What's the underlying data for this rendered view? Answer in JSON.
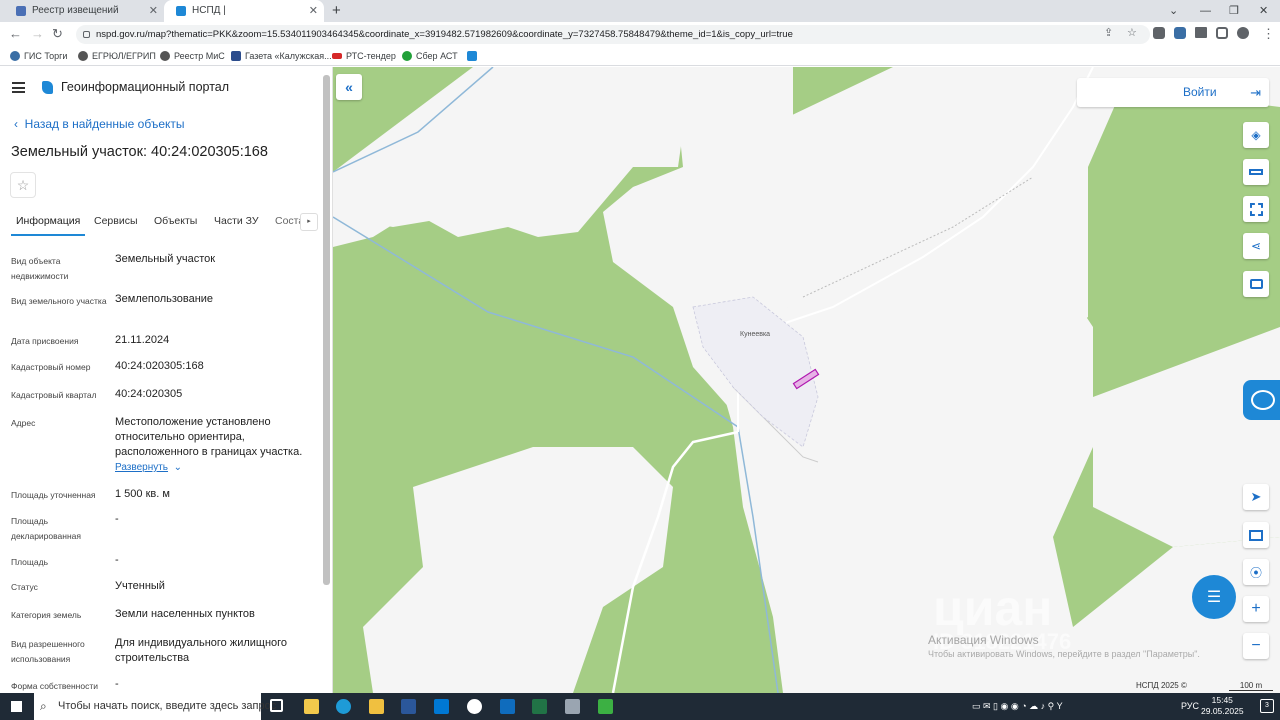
{
  "browser": {
    "tabs": [
      {
        "title": "Реестр извещений",
        "active": false
      },
      {
        "title": "НСПД | Геоинформационный п",
        "active": true
      }
    ],
    "url": "nspd.gov.ru/map?thematic=PKK&zoom=15.534011903464345&coordinate_x=3919482.571982609&coordinate_y=7327458.75848479&theme_id=1&is_copy_url=true",
    "bookmarks": [
      "ГИС Торги",
      "ЕГРЮЛ/ЕГРИП",
      "Реестр МиС",
      "Газета «Калужская...",
      "РТС-тендер",
      "Сбер АСТ"
    ]
  },
  "sidebar": {
    "portal_title": "Геоинформационный портал",
    "back_label": "Назад в найденные объекты",
    "object_title": "Земельный участок: 40:24:020305:168",
    "tabs": [
      "Информация",
      "Сервисы",
      "Объекты",
      "Части ЗУ",
      "Соста"
    ],
    "rows": [
      {
        "label": "Вид объекта недвижимости",
        "value": "Земельный участок"
      },
      {
        "label": "Вид земельного участка",
        "value": "Землепользование"
      },
      {
        "label": "Дата присвоения",
        "value": "21.11.2024"
      },
      {
        "label": "Кадастровый номер",
        "value": "40:24:020305:168"
      },
      {
        "label": "Кадастровый квартал",
        "value": "40:24:020305"
      },
      {
        "label": "Адрес",
        "value": "Местоположение установлено относительно ориентира, расположенного в границах участка."
      },
      {
        "label": "Площадь уточненная",
        "value": "1 500 кв. м"
      },
      {
        "label": "Площадь декларированная",
        "value": "-"
      },
      {
        "label": "Площадь",
        "value": "-"
      },
      {
        "label": "Статус",
        "value": "Учтенный"
      },
      {
        "label": "Категория земель",
        "value": "Земли населенных пунктов"
      },
      {
        "label": "Вид разрешенного использования",
        "value": "Для индивидуального жилищного строительства"
      },
      {
        "label": "Форма собственности",
        "value": "-"
      }
    ],
    "expand_label": "Развернуть"
  },
  "map": {
    "login_label": "Войти",
    "locality": "Кунеевка",
    "copyright": "НСПД 2025 ©",
    "scale": "100 m",
    "watermark": "циан",
    "watermark_id": "ID 318221476",
    "activation_title": "Активация Windows",
    "activation_text": "Чтобы активировать Windows, перейдите в раздел \"Параметры\"."
  },
  "taskbar": {
    "search_placeholder": "Чтобы начать поиск, введите здесь запрос",
    "lang": "РУС",
    "time": "15:45",
    "date": "29.05.2025",
    "notification_count": "3"
  }
}
